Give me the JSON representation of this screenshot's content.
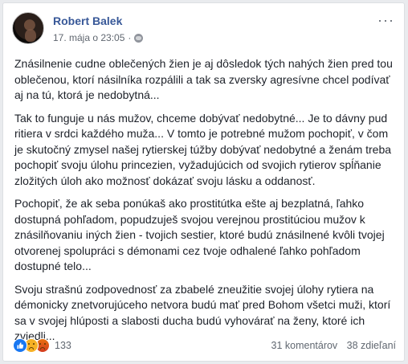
{
  "post": {
    "author": "Robert Balek",
    "timestamp": "17. mája o 23:05",
    "separator": "·",
    "privacy_icon": "globe-icon",
    "more_icon": "ellipsis-icon",
    "more_label": "···",
    "paragraphs": [
      "Znásilnenie cudne oblečených žien je aj dôsledok tých nahých žien pred tou oblečenou, ktorí násilníka rozpálili a tak sa zversky agresívne chcel podívať aj na tú, ktorá je nedobytná...",
      "Tak to funguje u nás mužov, chceme dobývať nedobytné... Je to dávny pud ritiera v srdci každého muža... V tomto je potrebné mužom pochopiť, v čom je skutočný zmysel našej rytierskej túžby dobývať nedobytné a ženám treba pochopiť svoju úlohu princezien, vyžadujúcich od svojich rytierov spĺňanie zložitých úloh ako možnosť dokázať svoju lásku a oddanosť.",
      "Pochopiť, že ak seba ponúkaš ako prostitútka ešte aj bezplatná, ľahko dostupná pohľadom, popudzuješ svojou verejnou prostitúciou mužov k znásilňovaniu iných žien - tvojich sestier, ktoré budú znásilnené kvôli tvojej otvorenej spolupráci s démonami cez tvoje odhalené ľahko pohľadom dostupné telo...",
      "Svoju strašnú zodpovednosť za zbabelé zneužitie svojej úlohy rytiera na démonicky znetvorujúceho netvora budú mať pred Bohom všetci muži, ktorí sa v svojej hlúposti a slabosti ducha budú vyhovárať na ženy, ktoré ich zviedli..."
    ]
  },
  "footer": {
    "reactions": [
      "like-reaction-icon",
      "sad-reaction-icon",
      "angry-reaction-icon"
    ],
    "reaction_count": "133",
    "comments": "31 komentárov",
    "shares": "38 zdieľaní"
  },
  "colors": {
    "author": "#385898",
    "meta": "#606770",
    "text": "#1d2129",
    "like": "#1877f2"
  }
}
